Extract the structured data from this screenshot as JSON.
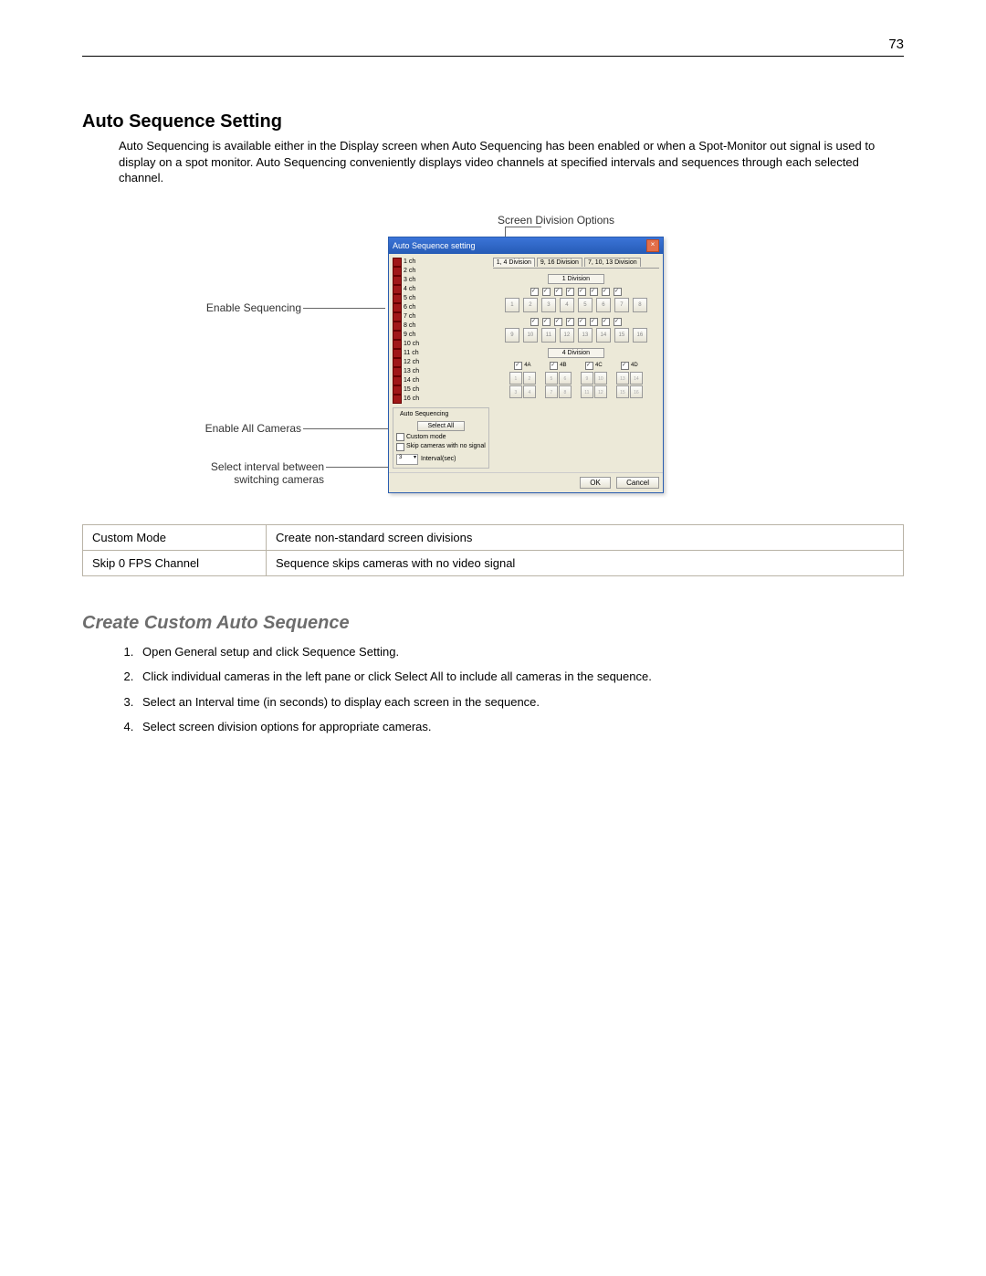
{
  "page_number": "73",
  "heading1": "Auto Sequence Setting",
  "intro": "Auto Sequencing is available either in the Display screen when Auto Sequencing has been enabled or when a Spot-Monitor out signal is used to display on a spot monitor. Auto Sequencing conveniently displays video channels at specified intervals and sequences through each selected channel.",
  "callouts": {
    "screen_div": "Screen Division Options",
    "enable_seq": "Enable Sequencing",
    "enable_all": "Enable All Cameras",
    "interval": "Select interval between switching cameras"
  },
  "dialog": {
    "title": "Auto Sequence setting",
    "tabs": [
      "1, 4 Division",
      "9, 16 Division",
      "7, 10, 13 Division"
    ],
    "division1_label": "1 Division",
    "division4_label": "4 Division",
    "four_labels": [
      "4A",
      "4B",
      "4C",
      "4D"
    ],
    "channels": [
      "1 ch",
      "2 ch",
      "3 ch",
      "4 ch",
      "5 ch",
      "6 ch",
      "7 ch",
      "8 ch",
      "9 ch",
      "10 ch",
      "11 ch",
      "12 ch",
      "13 ch",
      "14 ch",
      "15 ch",
      "16 ch"
    ],
    "auto_seq_group": "Auto Sequencing",
    "select_all": "Select All",
    "custom_mode": "Custom mode",
    "skip_nosignal": "Skip cameras with no signal",
    "interval_value": "3",
    "interval_label": "Interval(sec)",
    "ok": "OK",
    "cancel": "Cancel"
  },
  "table": [
    {
      "k": "Custom Mode",
      "v": "Create non-standard screen divisions"
    },
    {
      "k": "Skip 0 FPS Channel",
      "v": "Sequence skips cameras with no video signal"
    }
  ],
  "heading2": "Create Custom Auto Sequence",
  "steps": [
    "Open General setup and click Sequence Setting.",
    "Click individual cameras in the left pane or click Select All to include all cameras in the sequence.",
    "Select an Interval time (in seconds) to display each screen in the sequence.",
    "Select screen division options for appropriate cameras."
  ]
}
